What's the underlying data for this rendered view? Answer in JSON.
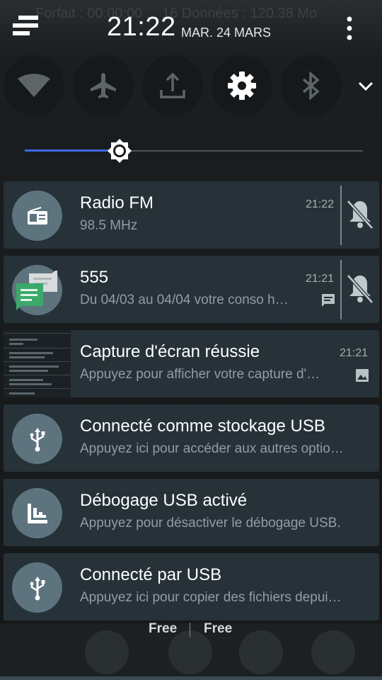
{
  "background": {
    "status_text": "Forfait : 00:00:00 ... 16 Données : 120.38 Mo"
  },
  "header": {
    "time": "21:22",
    "date": "MAR. 24 MARS"
  },
  "quick_settings": [
    {
      "icon": "wifi-icon",
      "state": "off"
    },
    {
      "icon": "airplane-icon",
      "state": "off"
    },
    {
      "icon": "data-transfer-icon",
      "state": "off"
    },
    {
      "icon": "gear-icon",
      "state": "on"
    },
    {
      "icon": "bluetooth-icon",
      "state": "off"
    }
  ],
  "brightness": {
    "level": 0.28
  },
  "notifications": [
    {
      "title": "Radio FM",
      "subtitle": "98.5 MHz",
      "time": "21:22",
      "icon": "radio-icon",
      "muted": true
    },
    {
      "title": "555",
      "subtitle": "Du 04/03 au 04/04 votre conso h…",
      "time": "21:21",
      "icon": "messaging-icon",
      "muted": true
    },
    {
      "title": "Capture d'écran réussie",
      "subtitle": "Appuyez pour afficher votre capture d'…",
      "time": "21:21",
      "icon": "screenshot-thumbnail"
    },
    {
      "title": "Connecté comme stockage USB",
      "subtitle": "Appuyez ici pour accéder aux autres optio…",
      "icon": "usb-icon"
    },
    {
      "title": "Débogage USB activé",
      "subtitle": "Appuyez pour désactiver le débogage USB.",
      "icon": "debug-icon"
    },
    {
      "title": "Connecté par USB",
      "subtitle": "Appuyez ici pour copier des fichiers depui…",
      "icon": "usb-icon"
    }
  ],
  "operators": [
    "Free",
    "Free"
  ],
  "colors": {
    "accent": "#3e6ae0",
    "card": "#263238",
    "icon_circle": "#5d737e"
  }
}
